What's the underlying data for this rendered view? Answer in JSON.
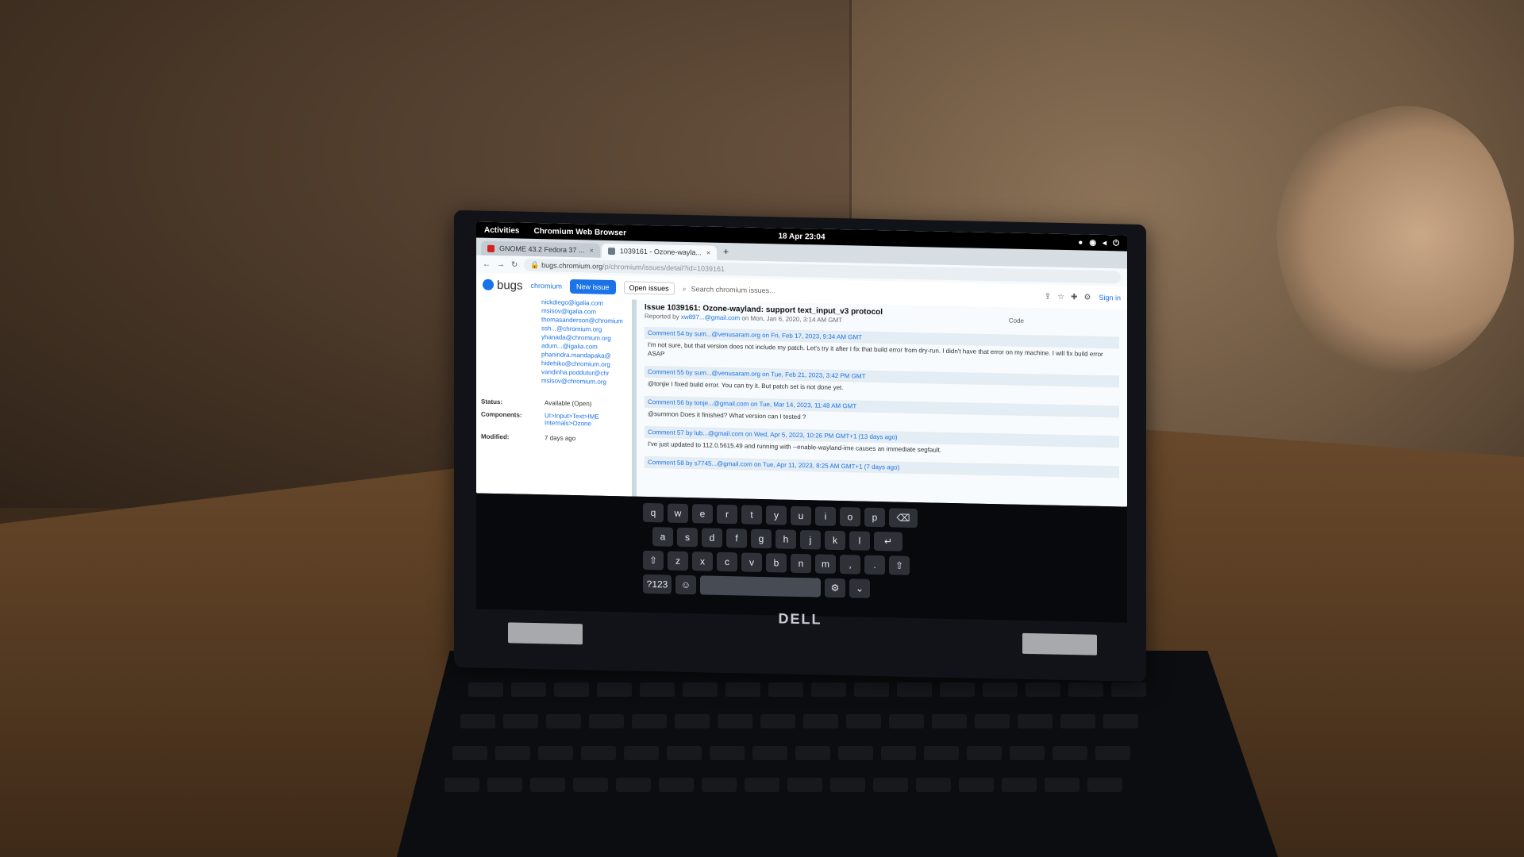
{
  "gnome": {
    "activities": "Activities",
    "app_name": "Chromium Web Browser",
    "clock": "18 Apr 23:04"
  },
  "browser": {
    "tabs": [
      {
        "label": "GNOME 43.2 Fedora 37 ..."
      },
      {
        "label": "1039161 - Ozone-wayla..."
      }
    ],
    "new_tab": "+",
    "url_host": "bugs.chromium.org",
    "url_path": "/p/chromium/issues/detail?id=1039161"
  },
  "tracker": {
    "brand": "bugs",
    "project": "chromium",
    "new_issue": "New issue",
    "can_select": "Open issues",
    "search_placeholder": "Search chromium issues...",
    "sign_in": "Sign in",
    "code": "Code",
    "cc_list": [
      "nickdiego@igalia.com",
      "msisov@igalia.com",
      "thomasanderson@chromium",
      "ssh...@chromium.org",
      "yhanada@chromium.org",
      "adum...@igalia.com",
      "phanindra.mandapaka@",
      "hidehiko@chromium.org",
      "vandinha.poddutur@chr",
      "msisov@chromium.org"
    ],
    "status_label": "Status:",
    "status_value": "Available (Open)",
    "components_label": "Components:",
    "components_value_1": "UI>Input>Text>IME",
    "components_value_2": "Internals>Ozone",
    "modified_label": "Modified:",
    "modified_value": "7 days ago",
    "issue_title": "Issue 1039161: Ozone-wayland: support text_input_v3 protocol",
    "reported_prefix": "Reported by",
    "reported_user": "xw897...@gmail.com",
    "reported_date": "on Mon, Jan 6, 2020, 3:14 AM GMT",
    "comments": [
      {
        "head": "Comment 54 by sum...@venusaram.org on Fri, Feb 17, 2023, 9:34 AM GMT",
        "body": "I'm not sure, but that version does not include my patch. Let's try it after I fix that build error from dry-run. I didn't have that error on my machine. I will fix build error ASAP"
      },
      {
        "head": "Comment 55 by sum...@venusaram.org on Tue, Feb 21, 2023, 3:42 PM GMT",
        "body": "@tonjie I fixed build error. You can try it. But patch set is not done yet."
      },
      {
        "head": "Comment 56 by tonje...@gmail.com on Tue, Mar 14, 2023, 11:48 AM GMT",
        "body": "@summon Does it finished? What version can I tested ?"
      },
      {
        "head": "Comment 57 by lub...@gmail.com on Wed, Apr 5, 2023, 10:26 PM GMT+1 (13 days ago)",
        "body": "I've just updated to 112.0.5615.49 and running with --enable-wayland-ime causes an immediate segfault."
      },
      {
        "head": "Comment 58 by s7745...@gmail.com on Tue, Apr 11, 2023, 8:25 AM GMT+1 (7 days ago)",
        "body": ""
      }
    ]
  },
  "keyboard": {
    "row1": [
      "q",
      "w",
      "e",
      "r",
      "t",
      "y",
      "u",
      "i",
      "o",
      "p",
      "⌫"
    ],
    "row2": [
      "a",
      "s",
      "d",
      "f",
      "g",
      "h",
      "j",
      "k",
      "l",
      "↵"
    ],
    "row3": [
      "⇧",
      "z",
      "x",
      "c",
      "v",
      "b",
      "n",
      "m",
      ",",
      ".",
      "⇧"
    ],
    "row4_left": "?123",
    "row4_emoji": "☺",
    "row4_settings": "⚙",
    "row4_hide": "⌄"
  },
  "laptop": {
    "brand": "DELL"
  },
  "colors": {
    "accent": "#1a73e8",
    "osk_key": "#2e3238"
  }
}
